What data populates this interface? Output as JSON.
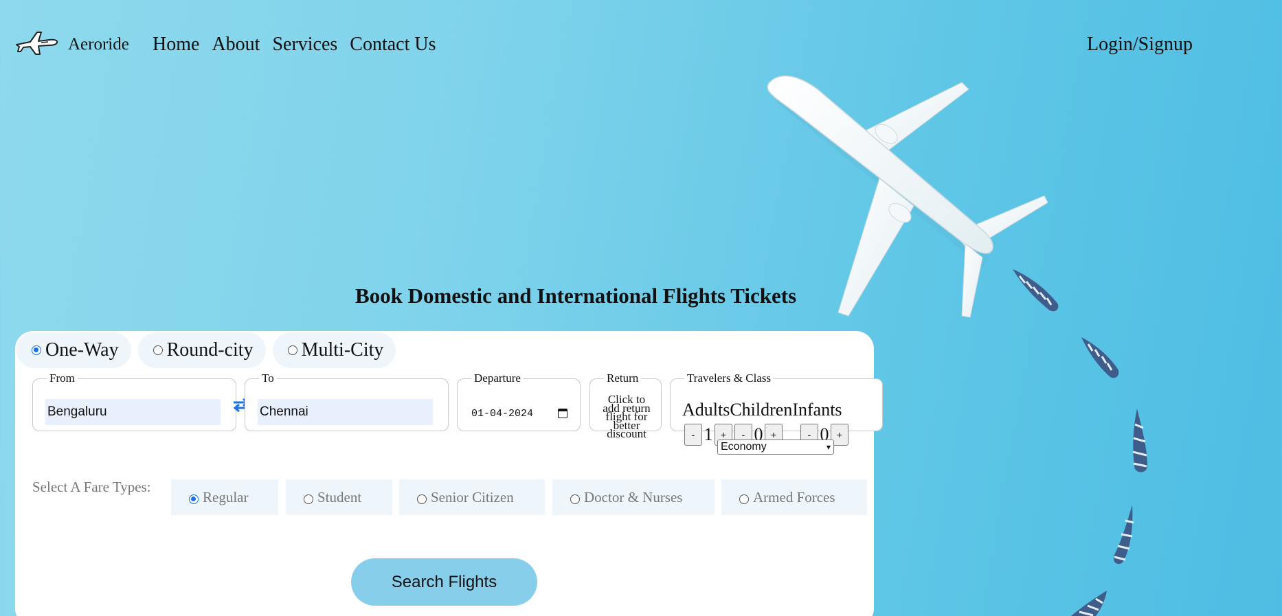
{
  "nav": {
    "brand": "Aeroride",
    "links": [
      "Home",
      "About",
      "Services",
      "Contact Us"
    ],
    "login": "Login/Signup"
  },
  "headline": "Book Domestic and International Flights Tickets",
  "trip_types": {
    "options": [
      "One-Way",
      "Round-city",
      "Multi-City"
    ],
    "selected": "One-Way"
  },
  "search": {
    "from_label": "From",
    "from_value": "Bengaluru",
    "to_label": "To",
    "to_value": "Chennai",
    "departure_label": "Departure",
    "departure_value": "01-04-2024",
    "return_label": "Return",
    "return_text": "Click to add return flight for better discount"
  },
  "travelers": {
    "label": "Travelers & Class",
    "adults_label": "Adults",
    "children_label": "Children",
    "infants_label": "Infants",
    "adults": "1",
    "children": "0",
    "infants": "0",
    "minus": "-",
    "plus": "+",
    "class_value": "Economy"
  },
  "fare": {
    "label": "Select A Fare Types:",
    "options": [
      "Regular",
      "Student",
      "Senior Citizen",
      "Doctor & Nurses",
      "Armed Forces"
    ],
    "selected": "Regular"
  },
  "search_button": "Search Flights",
  "icons": {
    "brand": "airplane-logo-icon",
    "swap": "swap-arrows-icon",
    "calendar": "calendar-icon"
  },
  "colors": {
    "accent": "#1a73e8",
    "button": "#87ceeb",
    "background": "#7fd3eb",
    "input_fill": "#e8f0fe"
  }
}
